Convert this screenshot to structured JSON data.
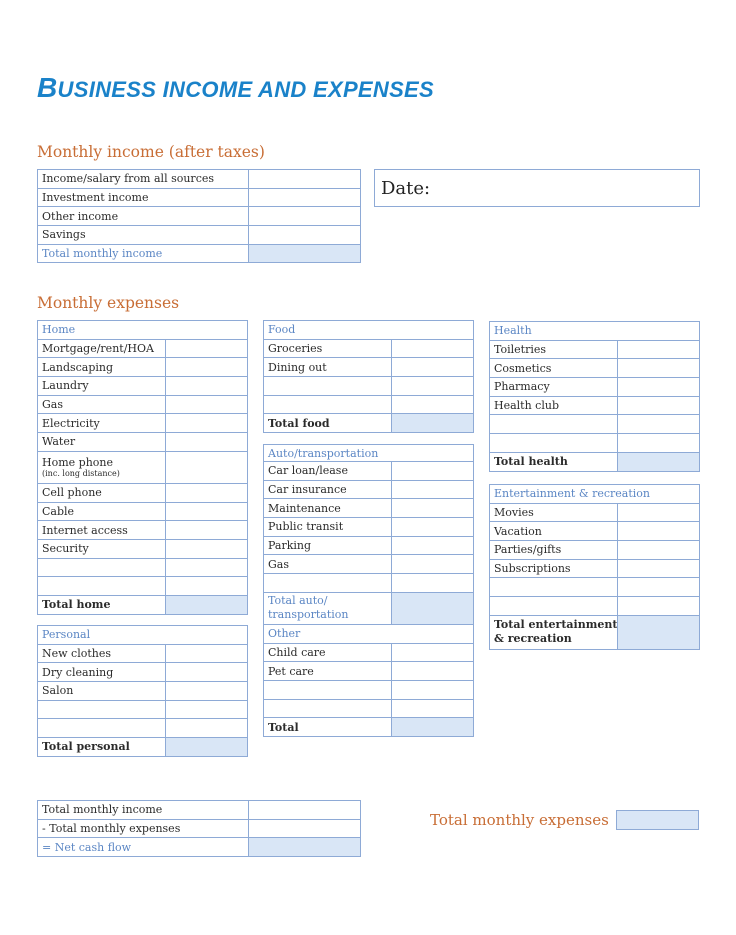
{
  "document": {
    "title_first_letter": "B",
    "title_rest": "USINESS INCOME AND EXPENSES",
    "title_full": "BUSINESS INCOME AND EXPENSES",
    "accent_color": "#1a82c9",
    "heading_color": "#c86d35",
    "border_color": "#8eaad6",
    "total_fill_color": "#d9e6f6"
  },
  "income": {
    "heading": "Monthly income (after taxes)",
    "rows": [
      "Income/salary from all sources",
      "Investment income",
      "Other income",
      "Savings"
    ],
    "total_label": "Total monthly income"
  },
  "date": {
    "label": "Date:"
  },
  "expenses": {
    "heading": "Monthly expenses",
    "home": {
      "header": "Home",
      "rows": [
        "Mortgage/rent/HOA",
        "Landscaping",
        "Laundry",
        "Gas",
        "Electricity",
        "Water"
      ],
      "home_phone": "Home phone",
      "home_phone_note": "(inc. long distance)",
      "rows2": [
        "Cell phone",
        "Cable",
        "Internet access",
        "Security"
      ],
      "total_label": "Total home"
    },
    "personal": {
      "header": "Personal",
      "rows": [
        "New clothes",
        "Dry cleaning",
        "Salon"
      ],
      "total_label": "Total personal"
    },
    "food": {
      "header": "Food",
      "rows": [
        "Groceries",
        "Dining out"
      ],
      "total_label": "Total food"
    },
    "auto": {
      "header": "Auto/transportation",
      "rows": [
        "Car loan/lease",
        "Car insurance",
        "Maintenance",
        "Public transit",
        "Parking",
        "Gas"
      ],
      "total_label_line1": "Total auto/",
      "total_label_line2": "transportation"
    },
    "other": {
      "header": "Other",
      "rows": [
        "Child care",
        "Pet care"
      ],
      "total_label": "Total"
    },
    "health": {
      "header": "Health",
      "rows": [
        "Toiletries",
        "Cosmetics",
        "Pharmacy",
        "Health club"
      ],
      "total_label": "Total health"
    },
    "entertainment": {
      "header": "Entertainment & recreation",
      "rows": [
        "Movies",
        "Vacation",
        "Parties/gifts",
        "Subscriptions"
      ],
      "total_label_line1": "Total entertainment",
      "total_label_line2": "& recreation"
    }
  },
  "summary": {
    "rows": [
      "Total monthly income",
      "- Total monthly expenses"
    ],
    "net_label": "= Net cash flow",
    "total_expenses_label": "Total monthly expenses"
  }
}
